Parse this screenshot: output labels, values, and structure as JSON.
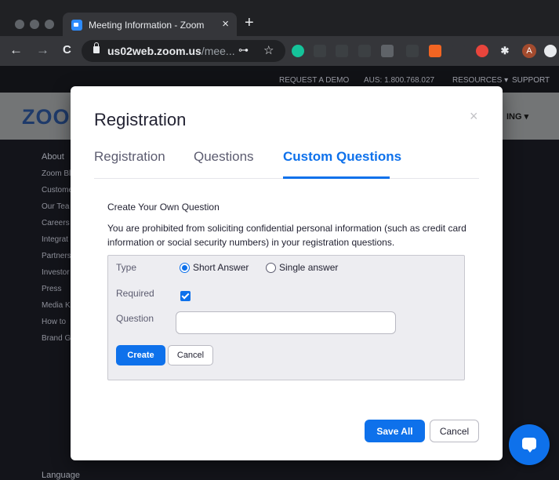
{
  "browser": {
    "tab_title": "Meeting Information - Zoom",
    "tab_close": "×",
    "new_tab": "+",
    "url_host": "us02web.zoom.us",
    "url_path": "/mee...",
    "back": "←",
    "forward": "→",
    "reload": "C",
    "key_icon": "⊶",
    "star_icon": "☆",
    "avatar_letter": "A"
  },
  "site": {
    "topbar": {
      "request_demo": "REQUEST A DEMO",
      "phone": "AUS: 1.800.768.027",
      "resources": "RESOURCES ▾",
      "support": "SUPPORT"
    },
    "logo_text": "ZOO",
    "right_menu": "ING ▾",
    "footer": {
      "heading": "About",
      "links": [
        "Zoom Bl",
        "Custome",
        "Our Tea",
        "Careers",
        "Integrat",
        "Partners",
        "Investor",
        "Press",
        "Media K",
        "How to",
        "Brand G"
      ],
      "language": "Language"
    }
  },
  "modal": {
    "title": "Registration",
    "close": "×",
    "tabs": [
      "Registration",
      "Questions",
      "Custom Questions"
    ],
    "active_tab_index": 2,
    "section_title": "Create Your Own Question",
    "warning": "You are prohibited from soliciting confidential personal information (such as credit card information or social security numbers) in your registration questions.",
    "form": {
      "type_label": "Type",
      "type_options": [
        "Short Answer",
        "Single answer"
      ],
      "selected_type": "Short Answer",
      "required_label": "Required",
      "required_checked": true,
      "question_label": "Question",
      "question_value": "",
      "create_label": "Create",
      "cancel_label": "Cancel"
    },
    "save_all_label": "Save All",
    "cancel_label": "Cancel"
  },
  "colors": {
    "accent": "#0e71eb",
    "text": "#232333"
  }
}
